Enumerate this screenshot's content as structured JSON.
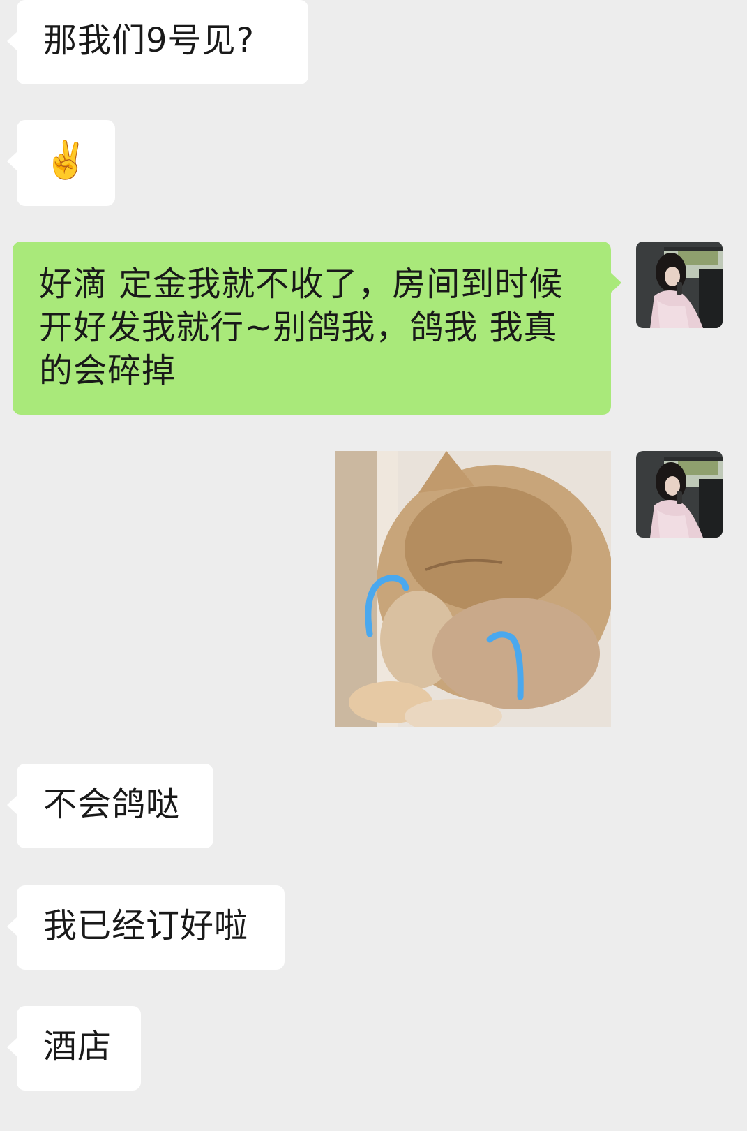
{
  "messages": {
    "m1": {
      "text": "那我们9号见?"
    },
    "m2": {
      "emoji": "✌️",
      "emoji_name": "victory-hand-emoji"
    },
    "m3": {
      "text": "好滴 定金我就不收了，房间到时候开好发我就行~别鸽我，鸽我 我真的会碎掉"
    },
    "m5": {
      "text": "不会鸽哒"
    },
    "m6": {
      "text": "我已经订好啦"
    },
    "m7": {
      "text": "酒店"
    }
  },
  "colors": {
    "background": "#ededed",
    "incoming_bubble": "#ffffff",
    "outgoing_bubble": "#a9e97a",
    "text": "#191919"
  },
  "sticker": {
    "subject": "crying-cat-sticker"
  },
  "avatar": {
    "subject": "user-avatar-photo"
  }
}
